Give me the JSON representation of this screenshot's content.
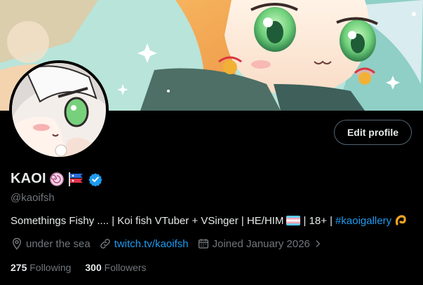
{
  "profile": {
    "name": "KAOI",
    "handle": "@kaoifsh",
    "edit_label": "Edit profile",
    "bio_text": "Somethings Fishy .... | Koi fish VTuber + VSinger | HE/HIM",
    "bio_after_flag": "| 18+ |",
    "bio_hashtag": "#kaoigallery",
    "location": "under the sea",
    "website": "twitch.tv/kaoifsh",
    "joined": "Joined January 2026",
    "following_count": "275",
    "following_label": "Following",
    "followers_count": "300",
    "followers_label": "Followers"
  },
  "icons": {
    "location": "location-pin-icon",
    "link": "link-icon",
    "calendar": "calendar-icon",
    "verified": "verified-badge-icon"
  },
  "colors": {
    "background": "#000000",
    "accent": "#1d9bf0",
    "muted": "#71767b",
    "text": "#e7e9ea",
    "button_border": "#536471"
  }
}
